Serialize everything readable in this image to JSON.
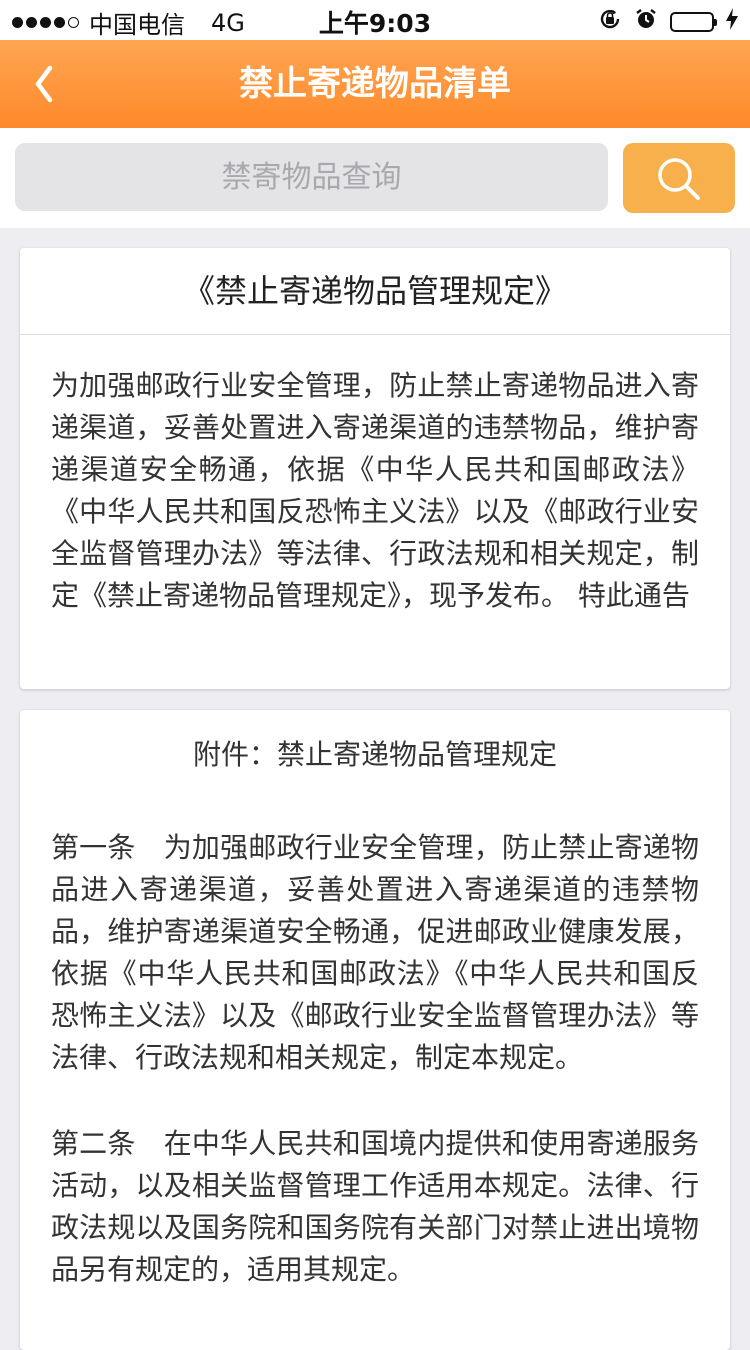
{
  "status_bar": {
    "carrier": "中国电信",
    "network": "4G",
    "time": "上午9:03"
  },
  "nav": {
    "title": "禁止寄递物品清单"
  },
  "search": {
    "placeholder": "禁寄物品查询"
  },
  "intro_card": {
    "title": "《禁止寄递物品管理规定》",
    "body": "为加强邮政行业安全管理，防止禁止寄递物品进入寄递渠道，妥善处置进入寄递渠道的违禁物品，维护寄递渠道安全畅通，依据《中华人民共和国邮政法》《中华人民共和国反恐怖主义法》以及《邮政行业安全监督管理办法》等法律、行政法规和相关规定，制定《禁止寄递物品管理规定》，现予发布。 特此通告"
  },
  "attachment_card": {
    "title": "附件：禁止寄递物品管理规定",
    "articles": [
      "第一条　为加强邮政行业安全管理，防止禁止寄递物品进入寄递渠道，妥善处置进入寄递渠道的违禁物品，维护寄递渠道安全畅通，促进邮政业健康发展，依据《中华人民共和国邮政法》《中华人民共和国反恐怖主义法》以及《邮政行业安全监督管理办法》等法律、行政法规和相关规定，制定本规定。",
      "第二条　在中华人民共和国境内提供和使用寄递服务活动，以及相关监督管理工作适用本规定。法律、行政法规以及国务院和国务院有关部门对禁止进出境物品另有规定的，适用其规定。"
    ]
  },
  "colors": {
    "nav_gradient_top": "#ffa552",
    "nav_gradient_bottom": "#ff8a2a",
    "search_button": "#f7b04b",
    "battery": "#4cd964"
  }
}
